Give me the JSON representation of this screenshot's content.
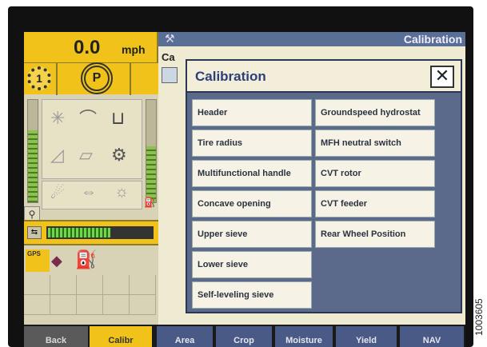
{
  "status": {
    "speed_value": "0.0",
    "speed_unit": "mph",
    "gear": "1",
    "park": "P"
  },
  "header": {
    "title": "Calibration",
    "partial_label": "Ca"
  },
  "dialog": {
    "title": "Calibration",
    "close_symbol": "✕",
    "left_items": [
      "Header",
      "Tire radius",
      "Multifunctional handle",
      "Concave opening",
      "Upper sieve",
      "Lower sieve",
      "Self-leveling sieve"
    ],
    "right_items": [
      "Groundspeed hydrostat",
      "MFH neutral switch",
      "CVT rotor",
      "CVT feeder",
      "Rear Wheel Position"
    ]
  },
  "icons": {
    "gps_label": "GPS"
  },
  "tabs": {
    "left": [
      "Back",
      "Calibr"
    ],
    "right": [
      "Area",
      "Crop",
      "Moisture",
      "Yield",
      "NAV"
    ]
  },
  "watermark": "1003605",
  "colors": {
    "accent_yellow": "#f0c21a",
    "dialog_blue": "#5b6a8a",
    "header_blue": "#5a6f96"
  }
}
